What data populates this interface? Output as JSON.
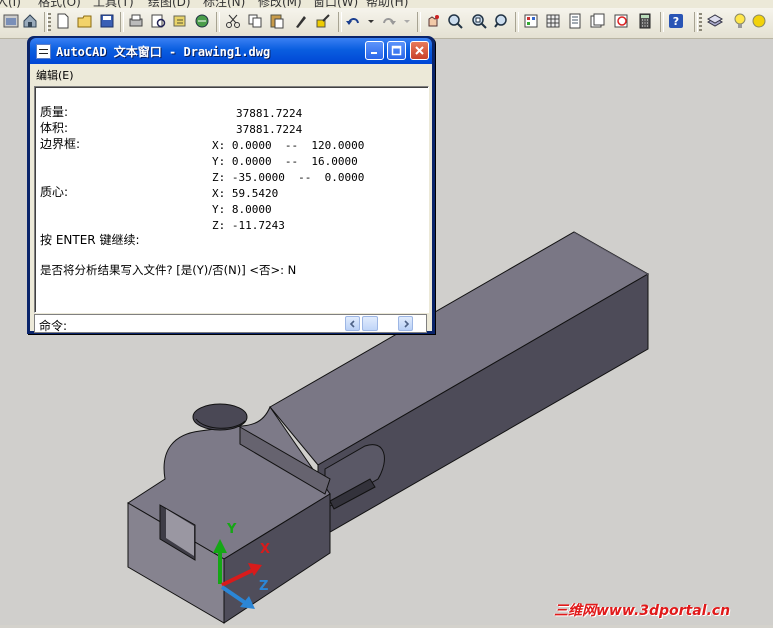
{
  "menubar": {
    "items": [
      "入(I)",
      "格式(O)",
      "工具(T)",
      "绘图(D)",
      "标注(N)",
      "修改(M)",
      "窗口(W)",
      "帮助(H)"
    ]
  },
  "toolbar": {
    "icons": [
      "new-icon",
      "open-icon",
      "save-icon",
      "print-icon",
      "plot-preview-icon",
      "publish-icon",
      "etransmit-icon",
      "cut-icon",
      "copy-icon",
      "paste-icon",
      "match-properties-icon",
      "block-editor-icon",
      "undo-icon",
      "redo-icon",
      "pan-icon",
      "zoom-realtime-icon",
      "zoom-window-icon",
      "zoom-previous-icon",
      "properties-icon",
      "design-center-icon",
      "tool-palettes-icon",
      "sheet-set-icon",
      "markup-icon",
      "calculator-icon",
      "help-icon",
      "layer-manager-icon",
      "lightbulb-icon",
      "sun-icon"
    ]
  },
  "text_window": {
    "title": "AutoCAD 文本窗口 - Drawing1.dwg",
    "menu": {
      "edit": "编辑",
      "shortcut": "(E)"
    },
    "output": {
      "mass_label": "质量:",
      "mass_value": "37881.7224",
      "volume_label": "体积:",
      "volume_value": "37881.7224",
      "bbox_label": "边界框:",
      "bbox_x": "X: 0.0000  --  120.0000",
      "bbox_y": "Y: 0.0000  --  16.0000",
      "bbox_z": "Z: -35.0000  --  0.0000",
      "centroid_label": "质心:",
      "centroid_x": "X: 59.5420",
      "centroid_y": "Y: 8.0000",
      "centroid_z": "Z: -11.7243",
      "continue_prompt": "按 ENTER 键继续:",
      "write_prompt": "是否将分析结果写入文件? [是(Y)/否(N)] <否>: N"
    },
    "command_label": "命令:"
  },
  "ucs": {
    "x": "X",
    "y": "Y",
    "z": "Z"
  },
  "watermark": "三维网www.3dportal.cn"
}
